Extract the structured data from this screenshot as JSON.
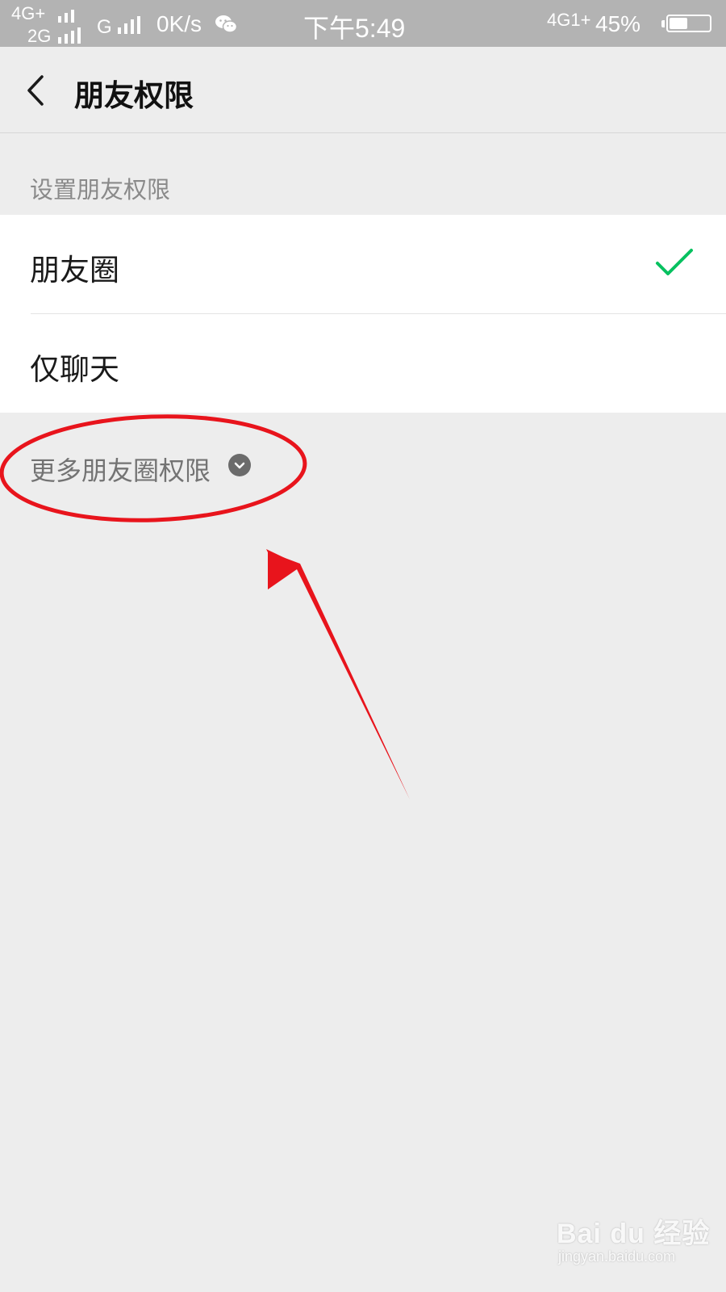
{
  "status_bar": {
    "network_1": "4G+",
    "network_2": "2G",
    "network_3": "G",
    "speed": "0K/s",
    "time": "下午5:49",
    "network_right": "4G1+",
    "battery_percent": "45%",
    "battery_level": 0.45,
    "app_icon": "wechat-icon"
  },
  "nav": {
    "back_icon": "back-chevron-icon",
    "title": "朋友权限"
  },
  "section": {
    "label": "设置朋友权限"
  },
  "options": [
    {
      "label": "朋友圈",
      "selected": true
    },
    {
      "label": "仅聊天",
      "selected": false
    }
  ],
  "more": {
    "label": "更多朋友圈权限",
    "icon": "chevron-down-circle-icon"
  },
  "colors": {
    "accent_check": "#07c160",
    "annotation_red": "#e8141c",
    "background": "#ededed"
  },
  "watermark": {
    "brand": "Bai du 经验",
    "url": "jingyan.baidu.com"
  }
}
